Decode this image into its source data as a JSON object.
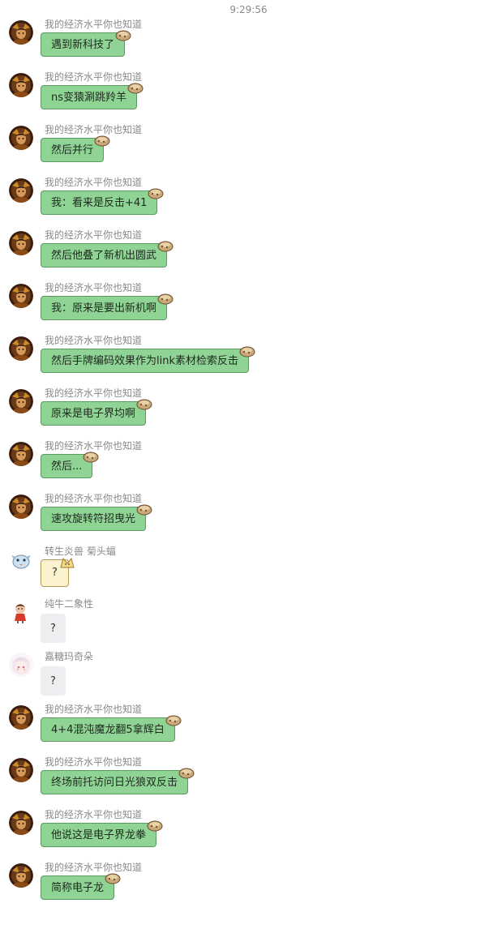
{
  "timestamp": "9:29:56",
  "colors": {
    "bubble_green": "#8fd395",
    "bubble_green_border": "#5a9a5e",
    "bubble_grey": "#eeeef1",
    "bubble_cream": "#fbf3cf",
    "name_text": "#8a8a8a"
  },
  "messages": [
    {
      "sender": "我的经济水平你也知道",
      "text": "遇到新科技了",
      "avatar": "portrait-avatar",
      "style": "green"
    },
    {
      "sender": "我的经济水平你也知道",
      "text": "ns变猿涮跳羚羊",
      "avatar": "portrait-avatar",
      "style": "green"
    },
    {
      "sender": "我的经济水平你也知道",
      "text": "然后并行",
      "avatar": "portrait-avatar",
      "style": "green"
    },
    {
      "sender": "我的经济水平你也知道",
      "text": "我：看来是反击+41",
      "avatar": "portrait-avatar",
      "style": "green"
    },
    {
      "sender": "我的经济水平你也知道",
      "text": "然后他叠了新机出圆武",
      "avatar": "portrait-avatar",
      "style": "green"
    },
    {
      "sender": "我的经济水平你也知道",
      "text": "我：原来是要出新机啊",
      "avatar": "portrait-avatar",
      "style": "green"
    },
    {
      "sender": "我的经济水平你也知道",
      "text": "然后手牌编码效果作为link素材检索反击",
      "avatar": "portrait-avatar",
      "style": "green"
    },
    {
      "sender": "我的经济水平你也知道",
      "text": "原来是电子界均啊",
      "avatar": "portrait-avatar",
      "style": "green"
    },
    {
      "sender": "我的经济水平你也知道",
      "text": "然后...",
      "avatar": "portrait-avatar",
      "style": "green"
    },
    {
      "sender": "我的经济水平你也知道",
      "text": "速攻旋转符招曳光",
      "avatar": "portrait-avatar",
      "style": "green"
    },
    {
      "sender": "转生炎兽 菊头蝠",
      "text": "?",
      "avatar": "bird-avatar",
      "style": "cream"
    },
    {
      "sender": "纯牛二象性",
      "text": "?",
      "avatar": "cartoon-avatar",
      "style": "grey"
    },
    {
      "sender": "嘉糖玛奇朵",
      "text": "?",
      "avatar": "anime-avatar",
      "style": "grey"
    },
    {
      "sender": "我的经济水平你也知道",
      "text": "4+4混沌魔龙翻5拿辉白",
      "avatar": "portrait-avatar",
      "style": "green"
    },
    {
      "sender": "我的经济水平你也知道",
      "text": "终场前托访问日光狼双反击",
      "avatar": "portrait-avatar",
      "style": "green"
    },
    {
      "sender": "我的经济水平你也知道",
      "text": "他说这是电子界龙拳",
      "avatar": "portrait-avatar",
      "style": "green"
    },
    {
      "sender": "我的经济水平你也知道",
      "text": "简称电子龙",
      "avatar": "portrait-avatar",
      "style": "green"
    }
  ]
}
